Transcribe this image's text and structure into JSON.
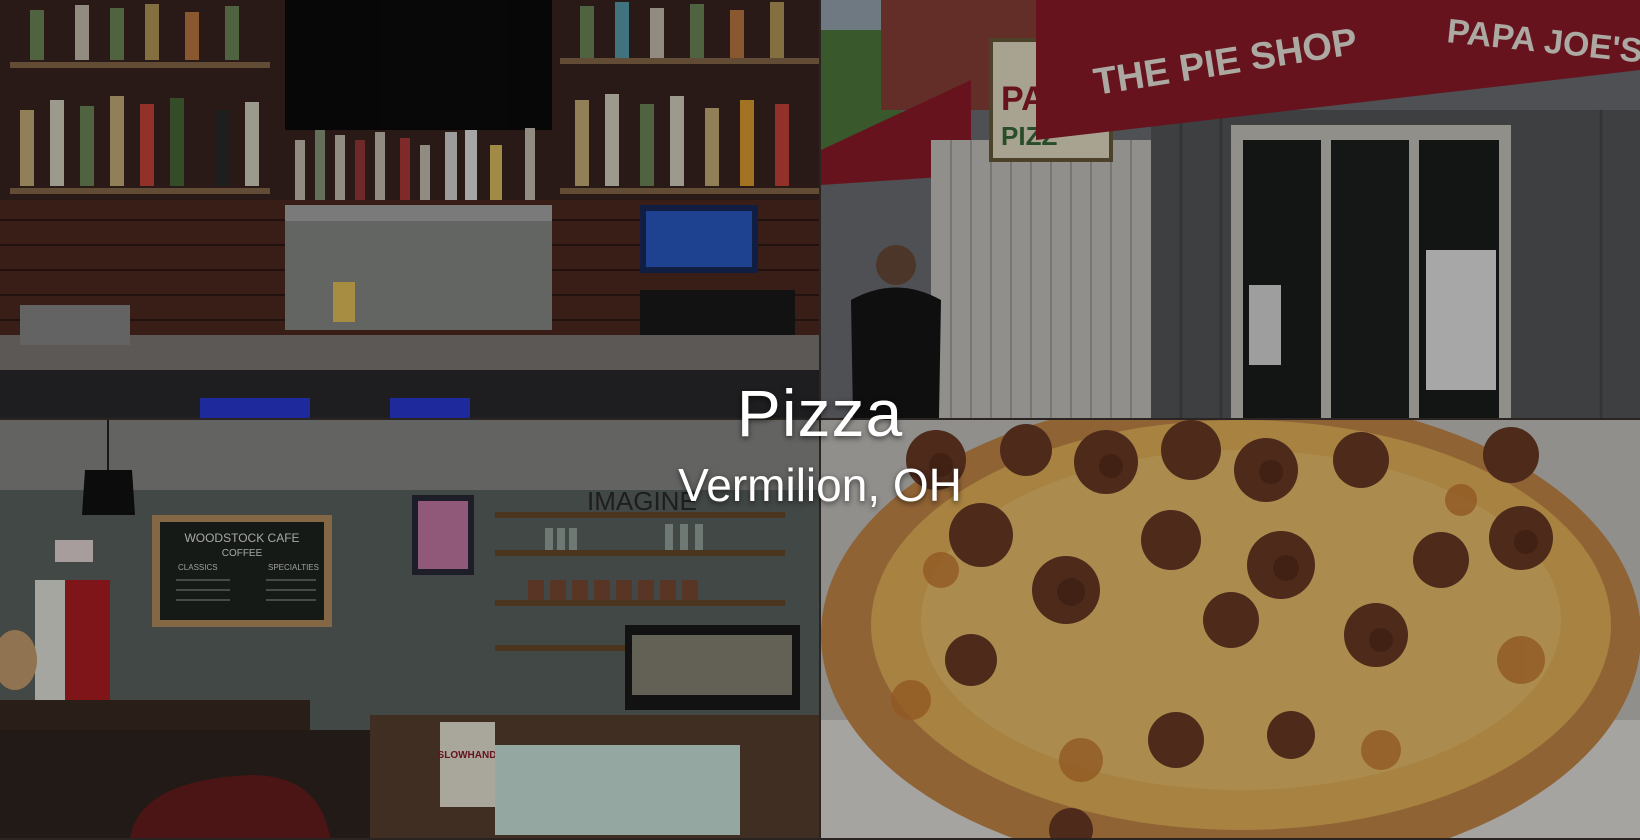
{
  "hero": {
    "title": "Pizza",
    "subtitle": "Vermilion, OH",
    "overlay_color": "#000000"
  },
  "tiles": [
    {
      "name": "bar-photo",
      "subject": "bar with liquor shelves and beer taps"
    },
    {
      "name": "storefront-photo",
      "subject": "pizza shop storefront with red awnings",
      "signs": [
        "THE PIE SHOP",
        "PAPA JOE'S",
        "PAPA",
        "PIZZ"
      ]
    },
    {
      "name": "cafe-photo",
      "subject": "cafe interior with chalkboard menu",
      "signs": [
        "WOODSTOCK CAFE",
        "COFFEE",
        "CLASSICS",
        "SPECIALTIES",
        "IMAGINE",
        "SLOWHAND"
      ]
    },
    {
      "name": "pizza-photo",
      "subject": "sausage pizza on a paper plate"
    }
  ],
  "colors": {
    "awning": "#8e1b2a",
    "brick": "#5a2e22",
    "cheese": "#e8b45a",
    "sausage": "#6b3b25",
    "chalkboard": "#1f2420"
  }
}
